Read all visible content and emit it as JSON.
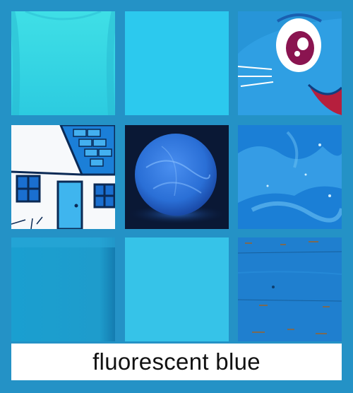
{
  "caption": {
    "text": "fluorescent blue"
  },
  "colors": {
    "frame": "#2492c6",
    "tshirt": "#35d4e0",
    "plain_swatch": "#2cc9ee",
    "cartoon_bg": "#2795d8",
    "house_blue": "#1a8fd8",
    "glow_ball": "#2a6fd6",
    "frost": "#1b7fd6",
    "fabric": "#1a9fd0",
    "light_swatch": "#36c3e8",
    "wood": "#1f7fcf",
    "caption_bg": "#ffffff"
  },
  "tiles": [
    {
      "icon": "tshirt-swatch"
    },
    {
      "icon": "solid-swatch"
    },
    {
      "icon": "cartoon-cat-face"
    },
    {
      "icon": "sketched-house"
    },
    {
      "icon": "glowing-orb"
    },
    {
      "icon": "frost-pattern"
    },
    {
      "icon": "fabric-swatch"
    },
    {
      "icon": "solid-swatch-light"
    },
    {
      "icon": "painted-wood"
    }
  ]
}
